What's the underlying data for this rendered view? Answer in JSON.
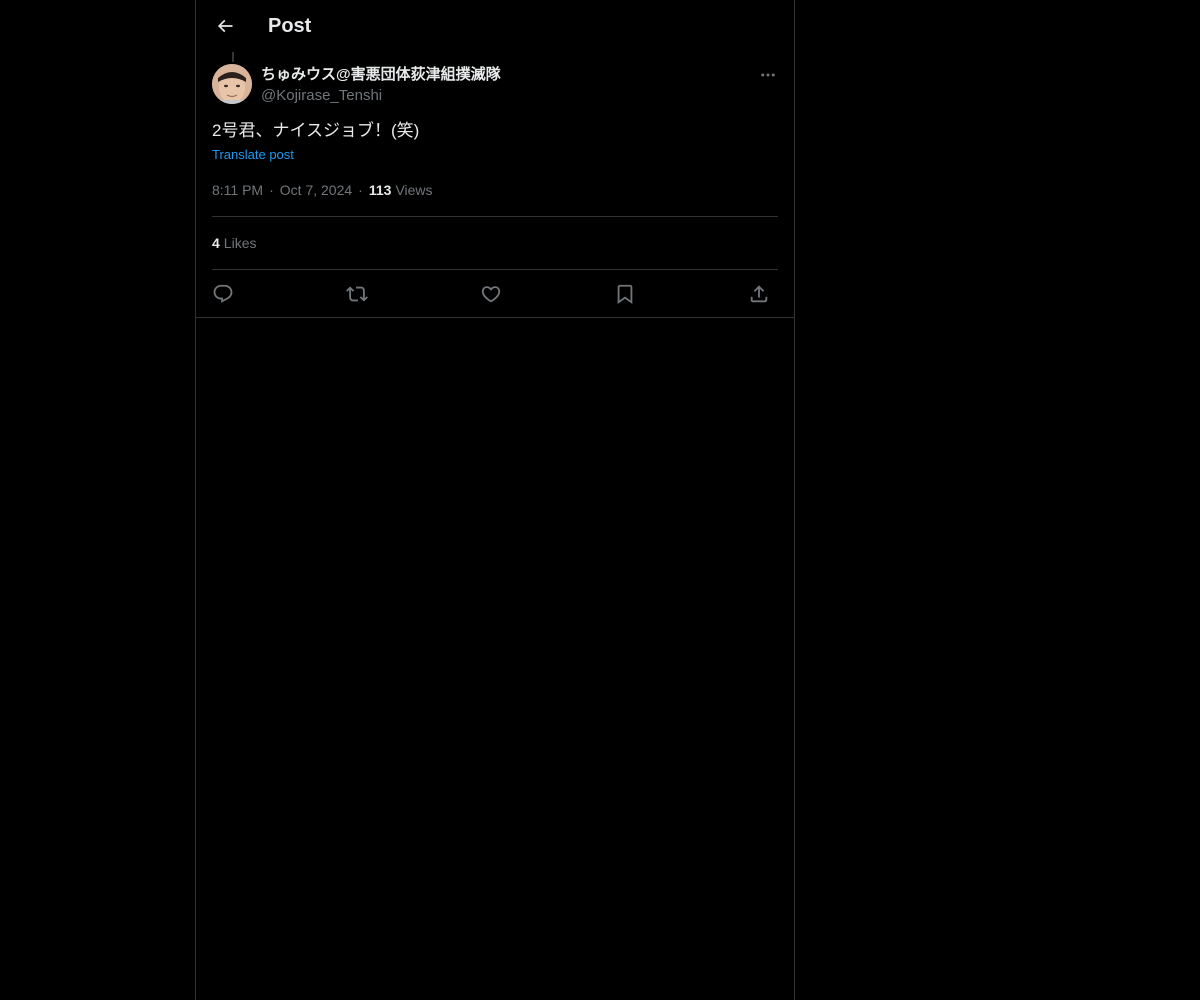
{
  "header": {
    "title": "Post",
    "back_icon": "arrow-left-icon"
  },
  "post": {
    "author": {
      "display_name": "ちゅみウス@害悪団体荻津組撲滅隊",
      "handle": "@Kojirase_Tenshi"
    },
    "text": "2号君、ナイスジョブ！(笑)",
    "translate_label": "Translate post",
    "time": "8:11 PM",
    "date": "Oct 7, 2024",
    "views_count": "113",
    "views_label": "Views",
    "likes_count": "4",
    "likes_label": "Likes"
  },
  "actions": {
    "icons": [
      "reply-icon",
      "repost-icon",
      "like-icon",
      "bookmark-icon",
      "share-icon"
    ]
  },
  "colors": {
    "background": "#000000",
    "text": "#e7e9ea",
    "secondary": "#71767b",
    "link": "#1d9bf0",
    "border": "#2f3336"
  }
}
